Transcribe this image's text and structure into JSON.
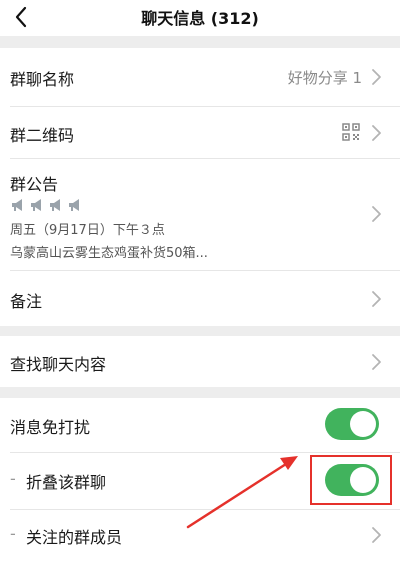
{
  "header": {
    "title": "聊天信息 (312)"
  },
  "rows": {
    "group_name": {
      "label": "群聊名称",
      "value": "好物分享 1"
    },
    "qr_code": {
      "label": "群二维码"
    },
    "announcement": {
      "label": "群公告",
      "line1": "周五（9月17日）下午３点",
      "line2": "乌蒙高山云雾生态鸡蛋补货50箱..."
    },
    "remark": {
      "label": "备注"
    },
    "search_chat": {
      "label": "查找聊天内容"
    },
    "mute": {
      "label": "消息免打扰",
      "enabled": true
    },
    "fold_group": {
      "label": "折叠该群聊",
      "enabled": true
    },
    "followed_members": {
      "label": "关注的群成员"
    }
  },
  "colors": {
    "toggle_on": "#41b35d",
    "highlight": "#e5312b",
    "background": "#ededed"
  },
  "icons": [
    "back-arrow-icon",
    "chevron-right-icon",
    "qr-code-icon",
    "megaphone-icon"
  ]
}
